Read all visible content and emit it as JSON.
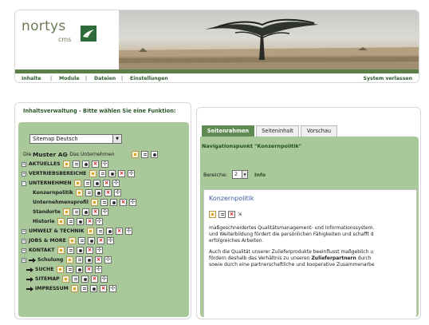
{
  "header": {
    "logo_text": "nortys",
    "logo_sub": "cms",
    "nav": [
      "Inhalte",
      "Module",
      "Dateien",
      "Einstellungen"
    ],
    "nav_separator": "|",
    "logout": "System verlassen"
  },
  "left": {
    "title": "Inhaltsverwaltung - Bitte wählen Sie eine Funktion:",
    "sitemap_select": "Sitemap Deutsch",
    "root_prefix": "Die",
    "root_name": "Muster AG",
    "root_suffix": "- Das Unternehmen",
    "tree": [
      {
        "label": "AKTUELLES",
        "expander": "+"
      },
      {
        "label": "VERTRIEBSBEREICHE",
        "expander": "+"
      },
      {
        "label": "UNTERNEHMEN",
        "expander": "-"
      },
      {
        "label": "Konzernpolitik",
        "expander": ""
      },
      {
        "label": "Unternehmensprofil",
        "expander": ""
      },
      {
        "label": "Standorte",
        "expander": ""
      },
      {
        "label": "Historie",
        "expander": ""
      },
      {
        "label": "UMWELT & TECHNIK",
        "expander": "+"
      },
      {
        "label": "JOBS & MORE",
        "expander": "+"
      },
      {
        "label": "KONTAKT",
        "expander": "+"
      },
      {
        "label": "Schulung",
        "expander": "+"
      },
      {
        "label": "SUCHE",
        "expander": ""
      },
      {
        "label": "SITEMAP",
        "expander": ""
      },
      {
        "label": "IMPRESSUM",
        "expander": ""
      }
    ],
    "delete_glyph": "×",
    "move_glyph": "✣"
  },
  "right": {
    "tabs": [
      "Seitenrahmen",
      "Seiteninhalt",
      "Vorschau"
    ],
    "active_tab": 0,
    "nav_point_title": "Navigationspunkt \"Konzernpolitik\"",
    "bereiche_label": "Bereiche:",
    "bereiche_value": "2",
    "info_link": "Info",
    "content_heading": "Konzernpolitik",
    "paragraph1": [
      "maßgeschneidertes Qualitätsmanagement- und Informationssystem.",
      "und Weiterbildung fördert die persönlichen Fähigkeiten und schafft d",
      "erfolgreiches Arbeiten."
    ],
    "paragraph2_line1": "Auch die Qualität unserer Zulieferprodukte beeinflusst maßgeblich u",
    "paragraph2_line2_before": "fördern deshalb das Verhältnis zu unseren",
    "paragraph2_line2_bold": "Zulieferpartnern",
    "paragraph2_line2_after": "durch",
    "paragraph2_line3": "sowie durch eine partnerschaftliche und kooperative Zusammenarbe"
  },
  "icons": {
    "logo": "bird-logo-icon",
    "edit": "edit-page-icon",
    "page": "page-properties-icon",
    "key": "permissions-icon",
    "delete": "delete-icon",
    "move": "move-icon"
  },
  "colors": {
    "accent_green": "#5f8a52",
    "panel_green": "#a9c99b",
    "nav_green": "#2c5a2c",
    "heading_blue": "#3c5a9a"
  }
}
